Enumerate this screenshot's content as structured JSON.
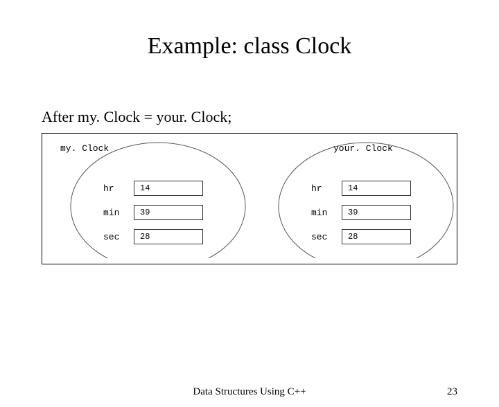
{
  "title": "Example: class Clock",
  "subtitle": "After my. Clock = your. Clock;",
  "left": {
    "name": "my. Clock",
    "fields": {
      "hr": {
        "label": "hr",
        "value": "14"
      },
      "min": {
        "label": "min",
        "value": "39"
      },
      "sec": {
        "label": "sec",
        "value": "28"
      }
    }
  },
  "right": {
    "name": "your. Clock",
    "fields": {
      "hr": {
        "label": "hr",
        "value": "14"
      },
      "min": {
        "label": "min",
        "value": "39"
      },
      "sec": {
        "label": "sec",
        "value": "28"
      }
    }
  },
  "footer": {
    "center": "Data Structures Using C++",
    "page": "23"
  }
}
